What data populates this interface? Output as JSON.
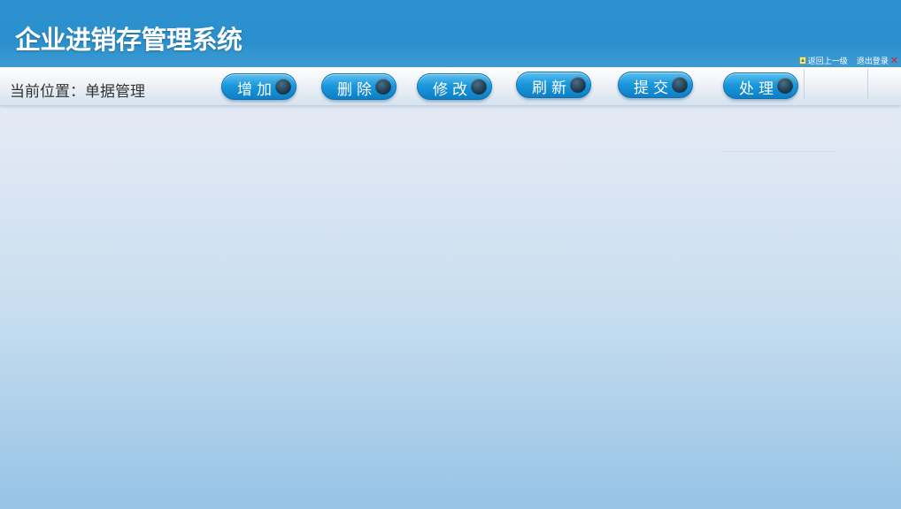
{
  "header": {
    "title": "企业进销存管理系统",
    "back_link": "返回上一级",
    "logout_link": "退出登录"
  },
  "toolbar": {
    "location": "当前位置：单据管理",
    "buttons": [
      {
        "label": "增加"
      },
      {
        "label": "删除"
      },
      {
        "label": "修改"
      },
      {
        "label": "刷新"
      },
      {
        "label": "提交"
      },
      {
        "label": "处理"
      }
    ]
  },
  "colors": {
    "header_blue": "#2a8fcd",
    "button_blue": "#1b98dd",
    "logout_x": "#e02020"
  },
  "icons": {
    "back": "up-arrow-icon",
    "logout": "close-icon",
    "button_knob": "circle-knob-icon"
  }
}
